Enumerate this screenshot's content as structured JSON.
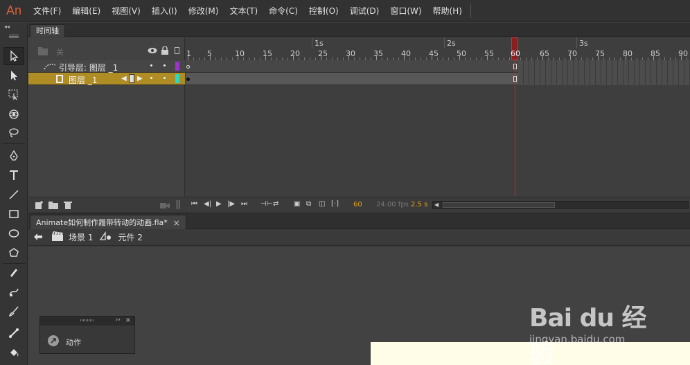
{
  "app": {
    "logo": "An"
  },
  "menu": [
    "文件(F)",
    "编辑(E)",
    "视图(V)",
    "插入(I)",
    "修改(M)",
    "文本(T)",
    "命令(C)",
    "控制(O)",
    "调试(D)",
    "窗口(W)",
    "帮助(H)"
  ],
  "timeline": {
    "tab_label": "时间轴",
    "header_label": "关",
    "layers": [
      {
        "name": "引导层: 图层 _1",
        "swatch": "#9b34c9"
      },
      {
        "name": "图层 _1",
        "swatch": "#2ad9c4",
        "selected": true
      }
    ],
    "seconds": [
      "1s",
      "2s",
      "3s"
    ],
    "frame_numbers": [
      "1",
      "5",
      "10",
      "15",
      "20",
      "25",
      "30",
      "35",
      "40",
      "45",
      "50",
      "55",
      "60",
      "65",
      "70",
      "75",
      "80",
      "85",
      "90"
    ],
    "current_frame": "60",
    "fps": "24.00 fps",
    "elapsed": "2.5 s",
    "accent": "#e0a020",
    "playhead_color": "#c02828"
  },
  "document": {
    "tab_label": "Animate如何制作履带转动的动画.fla*",
    "close": "×",
    "scene": "场景 1",
    "symbol": "元件 2"
  },
  "actions_panel": {
    "label": "动作",
    "expand": "››",
    "close": "×"
  },
  "watermark": {
    "text": "Bai du 经验",
    "sub": "jingyan.baidu.com"
  }
}
